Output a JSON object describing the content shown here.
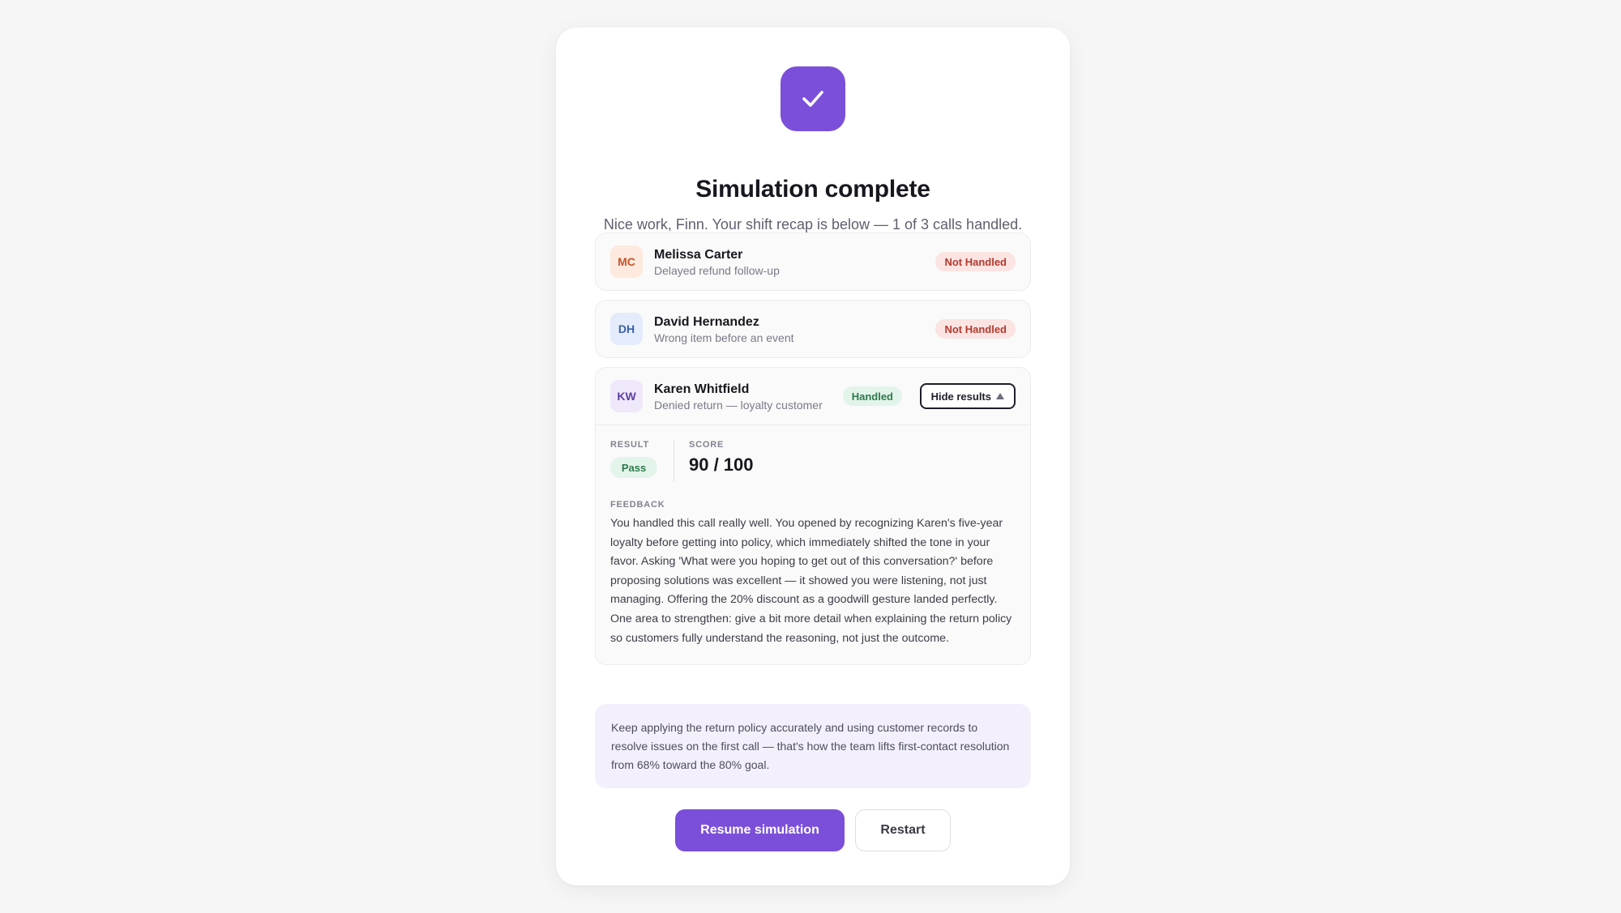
{
  "header": {
    "icon": "check-icon",
    "title": "Simulation complete",
    "subtitle": "Nice work, Finn. Your shift recap is below — 1 of 3 calls handled."
  },
  "calls": [
    {
      "initials": "MC",
      "name": "Melissa Carter",
      "topic": "Delayed refund follow-up",
      "status": "Not Handled"
    },
    {
      "initials": "DH",
      "name": "David Hernandez",
      "topic": "Wrong item before an event",
      "status": "Not Handled"
    },
    {
      "initials": "KW",
      "name": "Karen Whitfield",
      "topic": "Denied return — loyalty customer",
      "status": "Handled",
      "toggle_label": "Hide results",
      "results": {
        "result_label": "RESULT",
        "result_value": "Pass",
        "score_label": "SCORE",
        "score_value": "90 / 100",
        "feedback_label": "FEEDBACK",
        "feedback_text": "You handled this call really well. You opened by recognizing Karen's five-year loyalty before getting into policy, which immediately shifted the tone in your favor. Asking 'What were you hoping to get out of this conversation?' before proposing solutions was excellent — it showed you were listening, not just managing. Offering the 20% discount as a goodwill gesture landed perfectly. One area to strengthen: give a bit more detail when explaining the return policy so customers fully understand the reasoning, not just the outcome."
      }
    }
  ],
  "tip": "Keep applying the return policy accurately and using customer records to resolve issues on the first call — that's how the team lifts first-contact resolution from 68% toward the 80% goal.",
  "actions": {
    "resume_label": "Resume simulation",
    "restart_label": "Restart"
  },
  "colors": {
    "accent": "#7b4fd9",
    "not_handled": "#b33a2e",
    "handled": "#2e7a4c"
  }
}
